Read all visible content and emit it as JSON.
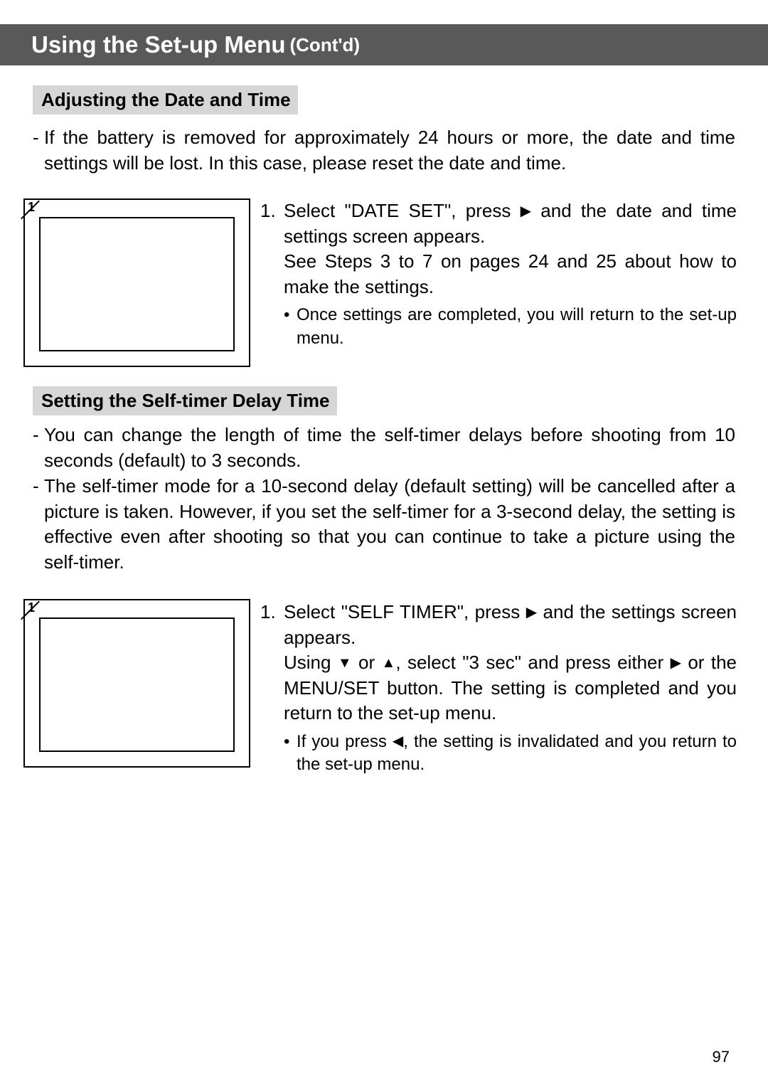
{
  "title": {
    "main": "Using the Set-up Menu",
    "sub": "(Cont'd)"
  },
  "section1": {
    "heading": "Adjusting the Date and Time",
    "intro": "If the battery is removed for approximately 24 hours or more, the date and time settings will be lost.  In this case, please reset the date and time.",
    "figure_num": "1",
    "step_num": "1.",
    "step_line1a": "Select \"DATE SET\", press ",
    "step_line1b": " and the date and time settings screen appears.",
    "step_line2": "See Steps 3 to 7 on pages 24 and 25 about how to make the settings.",
    "bullet": "Once settings are completed, you will return to the set-up menu."
  },
  "section2": {
    "heading": "Setting the Self-timer Delay Time",
    "intro1": "You can change the length of time the self-timer delays before shooting from 10 seconds (default) to 3 seconds.",
    "intro2": "The self-timer mode for a 10-second delay (default setting) will be cancelled after a picture is taken. However, if you set the self-timer for a 3-second delay, the setting is effective even after shooting so that you can continue to take a picture using the self-timer.",
    "figure_num": "1",
    "step_num": "1.",
    "step_line1a": "Select \"SELF TIMER\", press ",
    "step_line1b": " and the settings screen appears.",
    "step_line2a": "Using ",
    "step_line2b": " or ",
    "step_line2c": ", select \"3 sec\" and press either ",
    "step_line2d": " or the MENU/SET button. The setting is completed and you return to the set-up menu.",
    "bullet_a": "If you press ",
    "bullet_b": ", the setting is invalidated and you return to the set-up menu."
  },
  "icons": {
    "right": "▶",
    "left": "◀",
    "up": "▲",
    "down": "▼",
    "dot": "•"
  },
  "page_number": "97"
}
